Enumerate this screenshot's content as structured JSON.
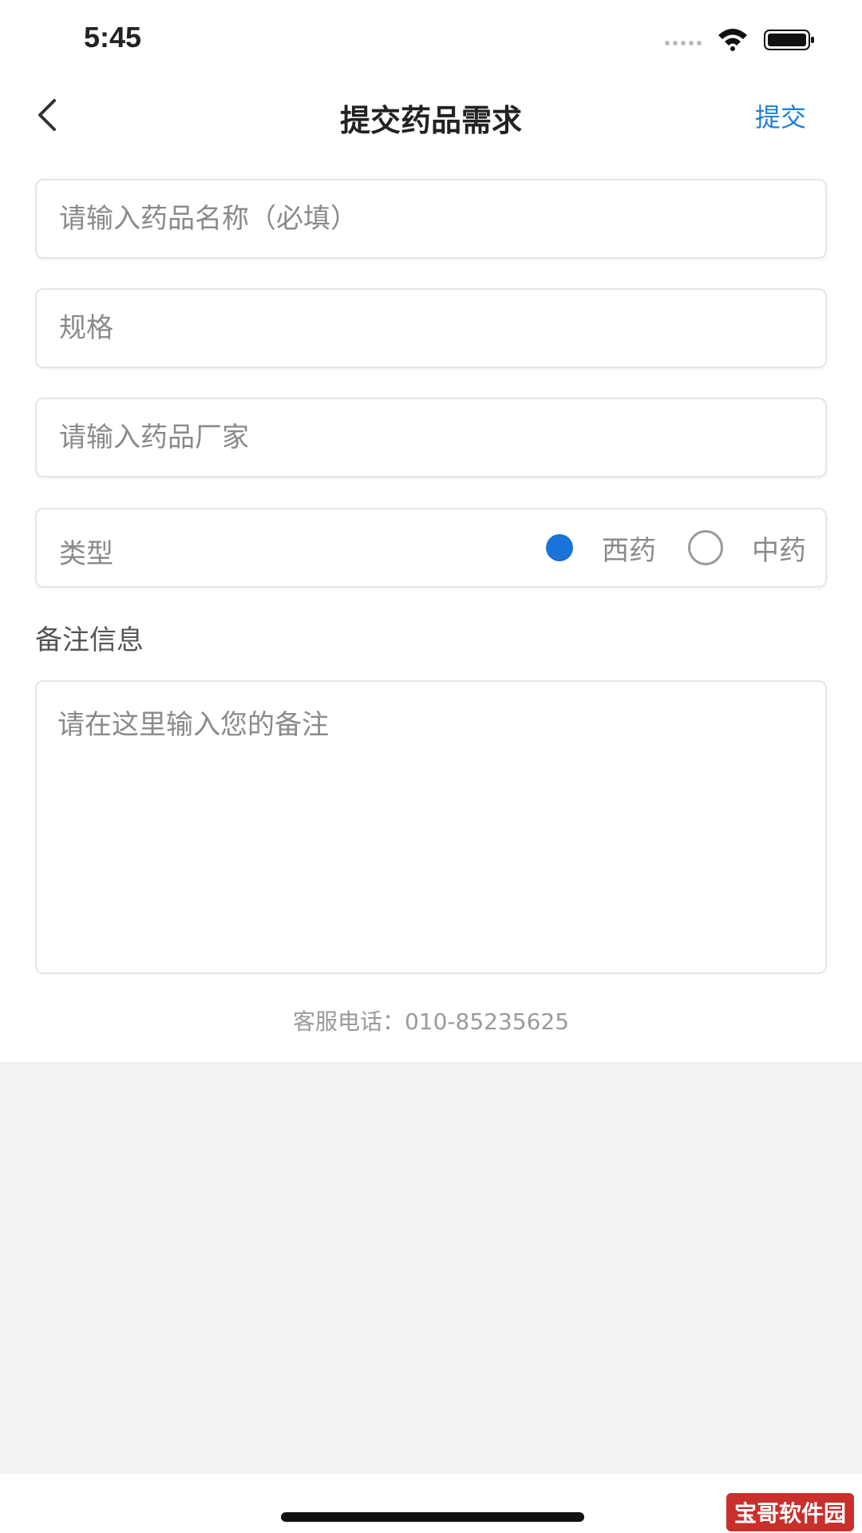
{
  "status_bar": {
    "time": "5:45"
  },
  "nav": {
    "title": "提交药品需求",
    "submit_label": "提交"
  },
  "form": {
    "drug_name_placeholder": "请输入药品名称（必填）",
    "spec_placeholder": "规格",
    "manufacturer_placeholder": "请输入药品厂家",
    "type_label": "类型",
    "type_options": [
      {
        "label": "西药",
        "selected": true
      },
      {
        "label": "中药",
        "selected": false
      }
    ],
    "remark_title": "备注信息",
    "remark_placeholder": "请在这里输入您的备注"
  },
  "footer": {
    "service_phone": "客服电话：010-85235625"
  },
  "watermark": "宝哥软件园",
  "colors": {
    "accent": "#1e7fd8",
    "radio_selected": "#1a73d9",
    "background": "#f2f2f2"
  }
}
